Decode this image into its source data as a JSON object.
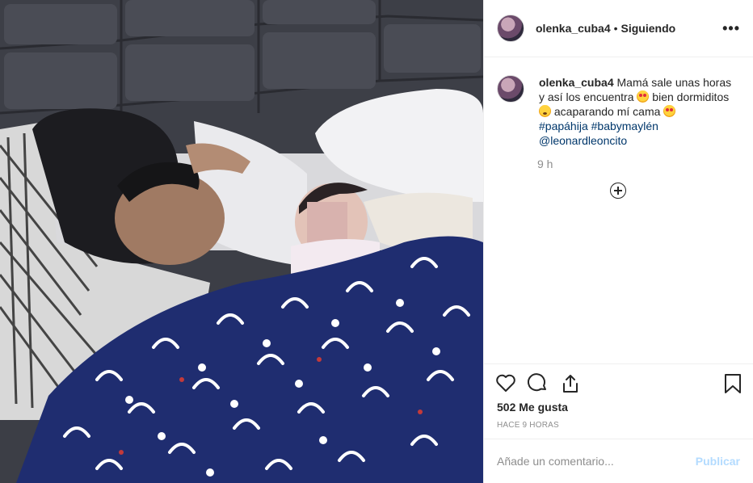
{
  "header": {
    "username": "olenka_cuba4",
    "separator": "•",
    "follow_status": "Siguiendo",
    "more_label": "•••"
  },
  "caption": {
    "username": "olenka_cuba4",
    "line1": "Mamá sale unas horas y así los encuentra",
    "line2": "bien dormiditos",
    "line3": "acaparando mí cama",
    "hashtag1": "#papáhija",
    "hashtag2": "#babymaylén",
    "mention": "@leonardleoncito",
    "emojis": [
      "heart-eyes-emoji",
      "sleeping-emoji",
      "heart-eyes-emoji"
    ]
  },
  "time_ago_short": "9 h",
  "likes": "502 Me gusta",
  "time_ago_long": "HACE 9 HORAS",
  "comment": {
    "placeholder": "Añade un comentario...",
    "publish_label": "Publicar"
  },
  "icons": [
    "heart-icon",
    "comment-icon",
    "share-icon",
    "bookmark-icon",
    "add-comment-icon",
    "more-icon"
  ],
  "colors": {
    "link": "#00376b",
    "muted": "#8e8e8e",
    "publish_disabled": "#b3dbff",
    "border": "#efefef"
  }
}
